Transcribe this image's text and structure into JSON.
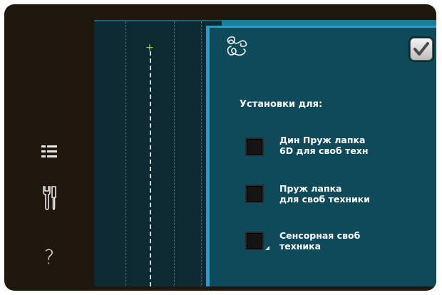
{
  "sidebar": {
    "items": [
      {
        "name": "menu-list",
        "icon": "list-icon"
      },
      {
        "name": "settings",
        "icon": "tools-icon"
      },
      {
        "name": "help",
        "icon": "help-icon",
        "label": "?"
      }
    ]
  },
  "panel": {
    "header_icon": "free-motion-icon",
    "confirm_icon": "checkmark-icon",
    "title": "Установки для:",
    "options": [
      {
        "line1": "Дин Пруж лапка",
        "line2": "6D для своб техн"
      },
      {
        "line1": "Пруж лапка",
        "line2": "для своб техники"
      },
      {
        "line1": "Сенсорная своб",
        "line2": "техника"
      }
    ]
  },
  "colors": {
    "panel_bg": "#0f4a5a",
    "panel_border": "#2c9bc7",
    "screen_bg": "#0d2a33",
    "device_bezel": "#20180e"
  }
}
